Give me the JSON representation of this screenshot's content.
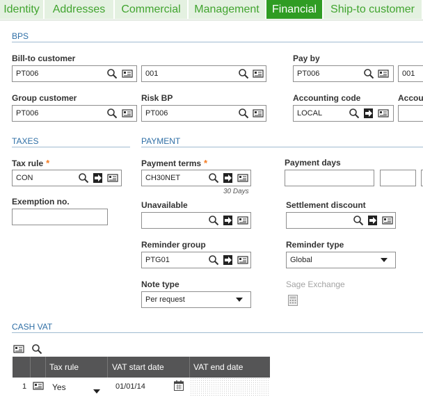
{
  "tabs": [
    {
      "label": "Identity"
    },
    {
      "label": "Addresses"
    },
    {
      "label": "Commercial"
    },
    {
      "label": "Management"
    },
    {
      "label": "Financial"
    },
    {
      "label": "Ship-to customer"
    }
  ],
  "active_tab": "Financial",
  "bps": {
    "heading": "BPS",
    "bill_to_customer": {
      "label": "Bill-to customer",
      "value": "PT006",
      "address": "001"
    },
    "pay_by": {
      "label": "Pay by",
      "value": "PT006",
      "address": "001"
    },
    "group_customer": {
      "label": "Group customer",
      "value": "PT006"
    },
    "risk_bp": {
      "label": "Risk BP",
      "value": "PT006"
    },
    "accounting_code": {
      "label": "Accounting code",
      "value": "LOCAL"
    },
    "accounting_cut": {
      "label": "Accou"
    }
  },
  "taxes": {
    "heading": "TAXES",
    "tax_rule": {
      "label": "Tax rule",
      "required_mark": "*",
      "value": "CON"
    },
    "exemption_no": {
      "label": "Exemption no.",
      "value": ""
    }
  },
  "payment": {
    "heading": "PAYMENT",
    "payment_terms": {
      "label": "Payment terms",
      "required_mark": "*",
      "value": "CH30NET",
      "hint": "30 Days"
    },
    "payment_days": {
      "label": "Payment days"
    },
    "unavailable": {
      "label": "Unavailable",
      "value": ""
    },
    "settlement_discount": {
      "label": "Settlement discount",
      "value": ""
    },
    "reminder_group": {
      "label": "Reminder group",
      "value": "PTG01"
    },
    "reminder_type": {
      "label": "Reminder type",
      "value": "Global"
    },
    "note_type": {
      "label": "Note type",
      "value": "Per request"
    },
    "sage_exchange": {
      "label": "Sage Exchange"
    }
  },
  "cash_vat": {
    "heading": "CASH VAT",
    "columns": [
      "Tax rule",
      "VAT start date",
      "VAT end date"
    ],
    "rows": [
      {
        "num": "1",
        "tax_rule": "Yes",
        "vat_start_date": "01/01/14",
        "vat_end_date": ""
      }
    ]
  },
  "colors": {
    "tab_active": "#2f9c23",
    "tab_inactive": "#e4f1e1",
    "tab_text": "#41a42f",
    "section_heading": "#2f6fa6",
    "required": "#f47a20",
    "grid_header": "#555556"
  }
}
